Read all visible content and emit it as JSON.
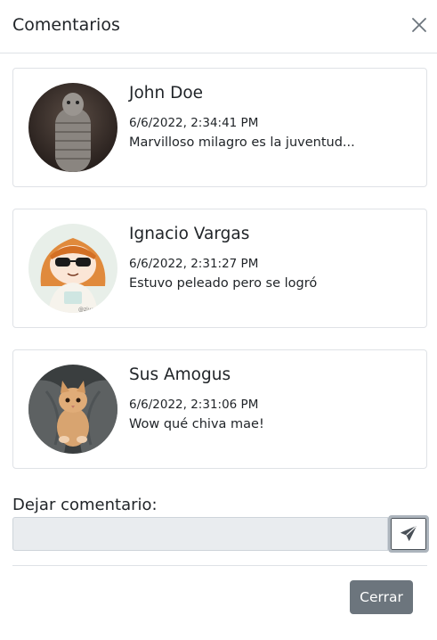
{
  "modal": {
    "title": "Comentarios",
    "close_icon": "close-icon"
  },
  "comments": [
    {
      "name": "John Doe",
      "date": "6/6/2022, 2:34:41 PM",
      "text": "Marvilloso milagro es la juventud...",
      "avatar": "photo-avatar"
    },
    {
      "name": "Ignacio Vargas",
      "date": "6/6/2022, 2:31:27 PM",
      "text": "Estuvo peleado pero se logró",
      "avatar": "anime-avatar"
    },
    {
      "name": "Sus Amogus",
      "date": "6/6/2022, 2:31:06 PM",
      "text": "Wow qué chiva mae!",
      "avatar": "kitten-avatar"
    }
  ],
  "form": {
    "label": "Dejar comentario:",
    "input_value": "",
    "send_icon": "paper-plane-icon"
  },
  "footer": {
    "close_label": "Cerrar"
  }
}
